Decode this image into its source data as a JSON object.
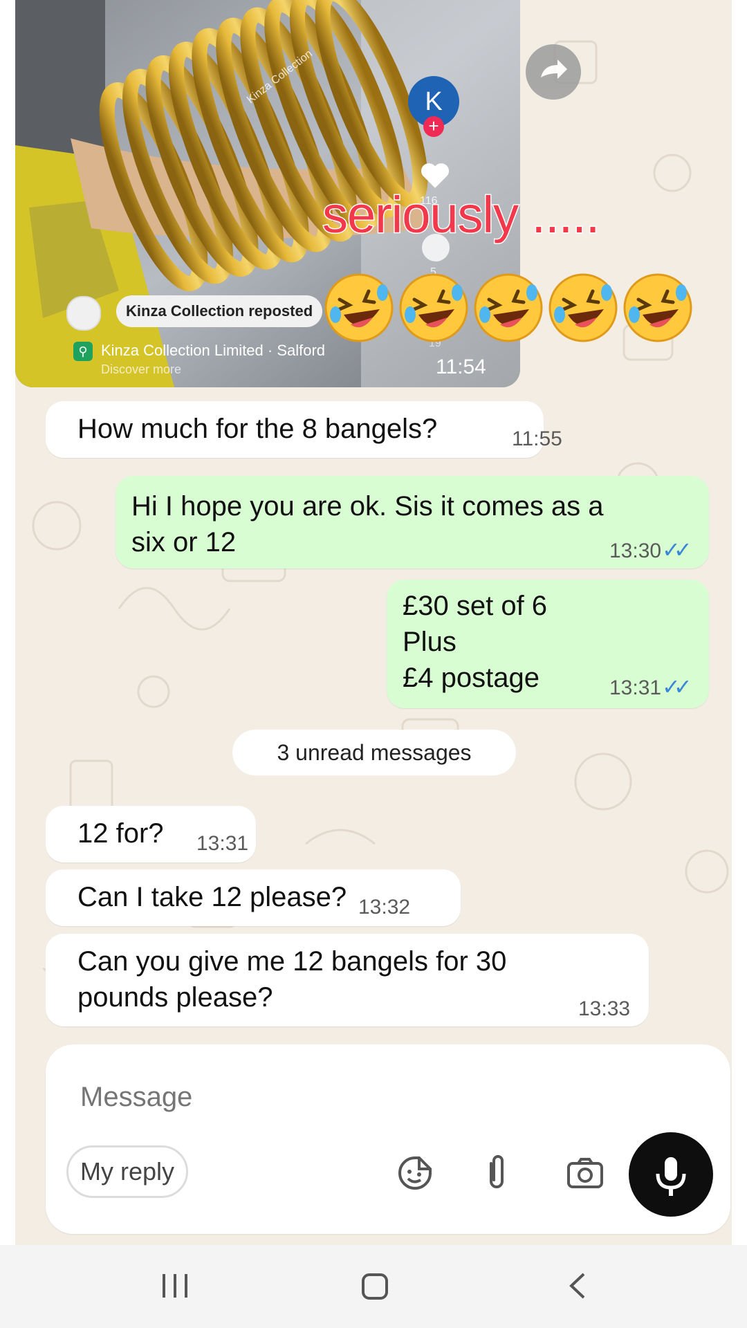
{
  "video": {
    "watermark": "Kinza Collection",
    "avatar_letter": "K",
    "like_count": "116",
    "comment_count": "5",
    "save_count": "19",
    "repost_label": "Kinza Collection reposted",
    "location": "Kinza Collection Limited · Salford",
    "discover": "Discover more",
    "time": "11:54"
  },
  "overlay": {
    "caption": "seriously .....",
    "emojis": [
      "🤣",
      "🤣",
      "🤣",
      "🤣",
      "🤣"
    ]
  },
  "messages": [
    {
      "direction": "in",
      "text": "How much for the 8 bangels?",
      "time": "11:55"
    },
    {
      "direction": "out",
      "lines": [
        "Hi I hope you are ok. Sis it comes as a",
        "six or 12"
      ],
      "time": "13:30",
      "status": "read"
    },
    {
      "direction": "out",
      "lines": [
        "£30  set of 6",
        "Plus",
        "£4 postage"
      ],
      "time": "13:31",
      "status": "read"
    },
    {
      "direction": "in",
      "text": "12 for?",
      "time": "13:31"
    },
    {
      "direction": "in",
      "text": "Can I take 12 please?",
      "time": "13:32"
    },
    {
      "direction": "in",
      "lines": [
        "Can you give me 12 bangels for 30",
        "pounds please?"
      ],
      "time": "13:33"
    }
  ],
  "unread_banner": "3 unread messages",
  "composer": {
    "placeholder": "Message",
    "reply_chip": "My reply"
  },
  "colors": {
    "chat_background": "#f3ede4",
    "outgoing_bubble": "#d9fdd3",
    "read_ticks": "#3a87d6",
    "overlay_text": "#f2384b"
  }
}
